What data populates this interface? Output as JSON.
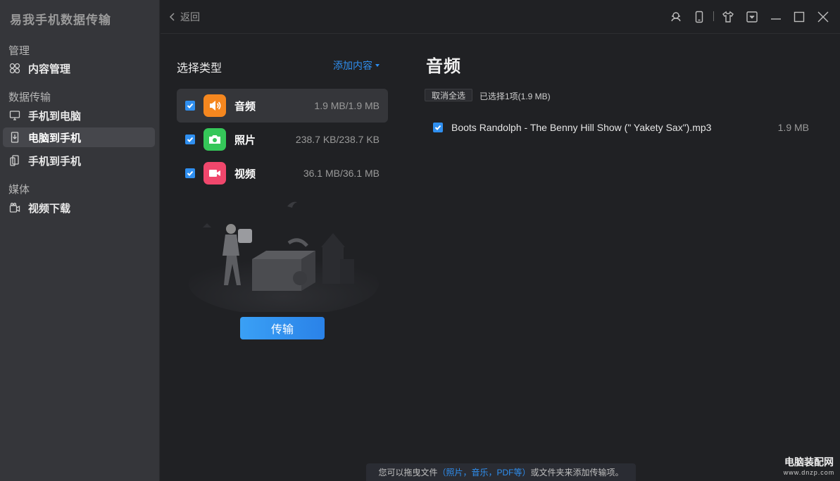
{
  "app": {
    "title": "易我手机数据传输"
  },
  "sidebar": {
    "groups": [
      {
        "label": "管理"
      },
      {
        "label": "数据传输"
      },
      {
        "label": "媒体"
      }
    ],
    "items": [
      {
        "label": "内容管理",
        "icon": "grid-icon"
      },
      {
        "label": "手机到电脑",
        "icon": "monitor-icon"
      },
      {
        "label": "电脑到手机",
        "icon": "phone-import-icon",
        "active": true
      },
      {
        "label": "手机到手机",
        "icon": "phone-phone-icon"
      },
      {
        "label": "视频下载",
        "icon": "video-download-icon"
      }
    ]
  },
  "topbar": {
    "back_label": "返回",
    "icons": [
      "user-support-icon",
      "phone-icon",
      "shirt-icon",
      "dropdown-menu-icon",
      "minimize-icon",
      "maximize-icon",
      "close-icon"
    ]
  },
  "middle": {
    "title": "选择类型",
    "add_content_label": "添加内容",
    "types": [
      {
        "name": "音频",
        "size": "1.9 MB/1.9 MB",
        "color": "#f5871f",
        "checked": true,
        "active": true
      },
      {
        "name": "照片",
        "size": "238.7 KB/238.7 KB",
        "color": "#35c759",
        "checked": true
      },
      {
        "name": "视频",
        "size": "36.1 MB/36.1 MB",
        "color": "#f0476c",
        "checked": true
      }
    ],
    "transfer_label": "传输"
  },
  "right": {
    "title": "音频",
    "deselect_label": "取消全选",
    "selected_info": "已选择1项(1.9 MB)",
    "files": [
      {
        "name": "Boots Randolph - The Benny Hill Show (\" Yakety Sax\").mp3",
        "size": "1.9 MB",
        "checked": true
      }
    ]
  },
  "hint": {
    "prefix": "您可以拖曳文件",
    "highlight": "（照片，音乐，PDF等）",
    "suffix": "或文件夹来添加传输项。"
  },
  "watermark": {
    "title": "电脑装配网",
    "url": "www.dnzp.com"
  },
  "colors": {
    "accent": "#2f8ff0",
    "sidebar_bg": "#35363a",
    "main_bg": "#202124"
  }
}
